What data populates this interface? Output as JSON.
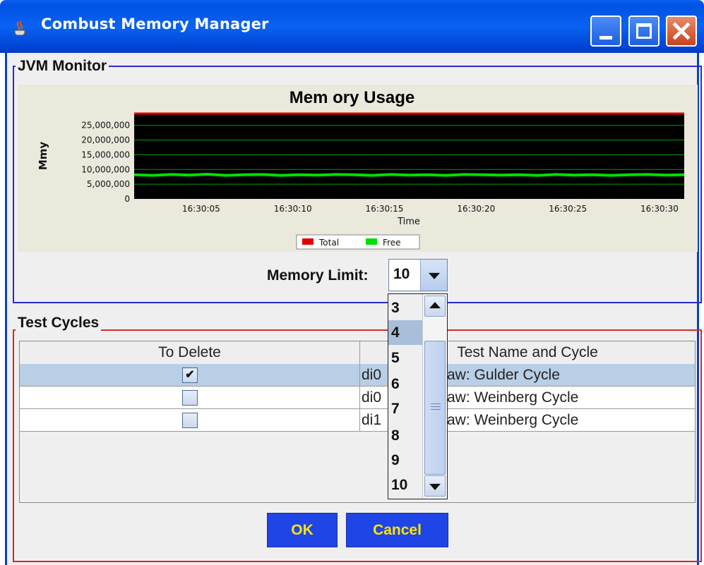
{
  "window": {
    "title": "Combust Memory Manager",
    "icon": "java-cup-icon",
    "controls": [
      "minimize-icon",
      "maximize-icon",
      "close-icon"
    ]
  },
  "jvm_monitor": {
    "group_title": "JVM Monitor",
    "memory_limit_label": "Memory Limit:",
    "memory_limit_value": "10",
    "dropdown_options": [
      "3",
      "4",
      "5",
      "6",
      "7",
      "8",
      "9",
      "10"
    ],
    "dropdown_highlighted": "4"
  },
  "chart_data": {
    "type": "line",
    "title": "Mem ory Usage",
    "xlabel": "Time",
    "ylabel": "Mmy",
    "x_ticks": [
      "16:30:05",
      "16:30:10",
      "16:30:15",
      "16:30:20",
      "16:30:25",
      "16:30:30"
    ],
    "y_ticks": [
      "0",
      "5,000,000",
      "10,000,000",
      "15,000,000",
      "20,000,000",
      "25,000,000"
    ],
    "ylim": [
      0,
      29000000
    ],
    "xlim": [
      0,
      30
    ],
    "grid": true,
    "legend_position": "bottom",
    "series": [
      {
        "name": "Total",
        "color": "#e00000",
        "values": [
          29000000,
          29000000
        ]
      },
      {
        "name": "Free",
        "color": "#00e000",
        "values": [
          8200000,
          8000000,
          8300000,
          8100000,
          8400000,
          8000000,
          8200000,
          8300000,
          8000000,
          8200000,
          8100000,
          8300000,
          8200000,
          8000000,
          8300000,
          8100000,
          8200000,
          8000000,
          8300000,
          8200000,
          8100000,
          8200000,
          8000000,
          8300000,
          8100000,
          8200000,
          8000000,
          8200000,
          8300000,
          8100000,
          8200000
        ]
      }
    ],
    "background": "#000000",
    "gridline_color": "#00a000"
  },
  "test_cycles": {
    "group_title": "Test Cycles",
    "columns": [
      "To Delete",
      "Test Name and Cycle"
    ],
    "rows": [
      {
        "checked": "✔",
        "col2_prefix": "di0",
        "col2_suffix": "aw:  Gulder Cycle",
        "selected": true
      },
      {
        "checked": "",
        "col2_prefix": "di0",
        "col2_suffix": "aw:  Weinberg Cycle",
        "selected": false
      },
      {
        "checked": "",
        "col2_prefix": "di1",
        "col2_suffix": "aw:  Weinberg Cycle",
        "selected": false
      }
    ]
  },
  "buttons": {
    "ok": "OK",
    "cancel": "Cancel"
  }
}
